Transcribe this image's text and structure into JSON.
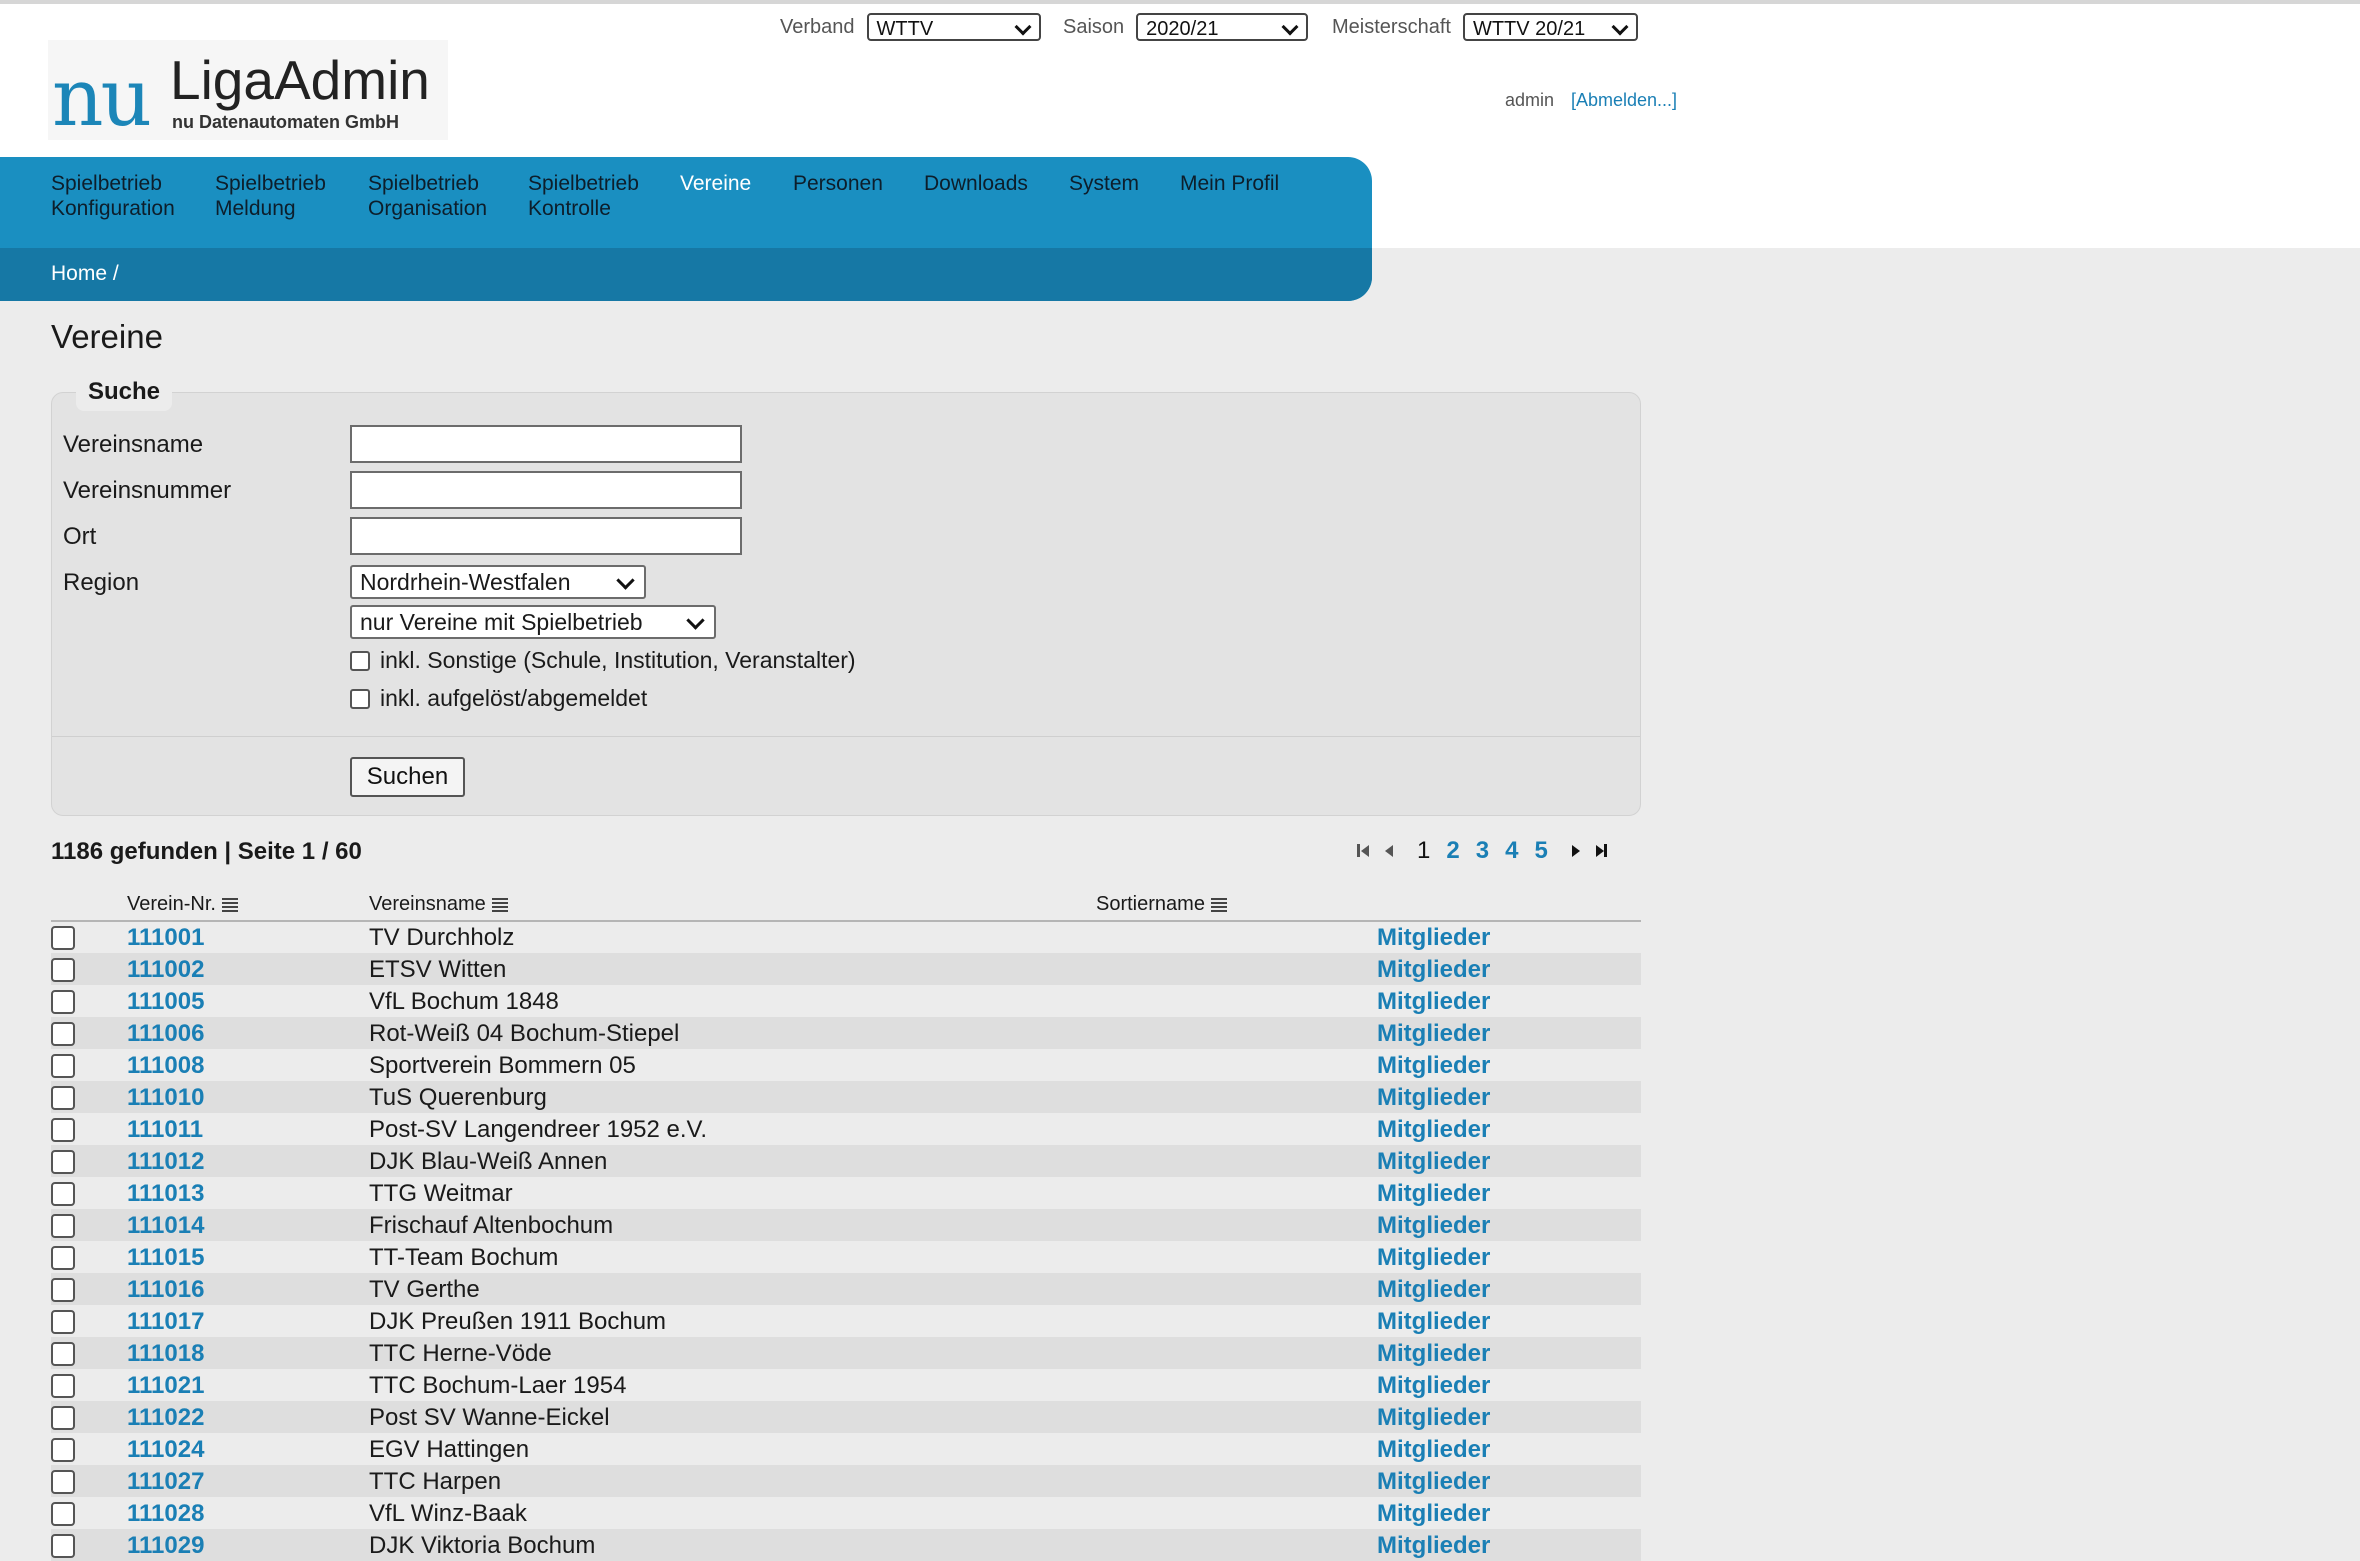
{
  "topbar": {
    "verband": {
      "label": "Verband",
      "value": "WTTV"
    },
    "saison": {
      "label": "Saison",
      "value": "2020/21"
    },
    "meisterschaft": {
      "label": "Meisterschaft",
      "value": "WTTV 20/21"
    }
  },
  "logo": {
    "nu": "nu",
    "title": "LigaAdmin",
    "subtitle": "nu Datenautomaten GmbH"
  },
  "user": {
    "name": "admin",
    "logout": "[Abmelden...]"
  },
  "nav": {
    "items": [
      {
        "line1": "Spielbetrieb",
        "line2": "Konfiguration"
      },
      {
        "line1": "Spielbetrieb",
        "line2": "Meldung"
      },
      {
        "line1": "Spielbetrieb",
        "line2": "Organisation"
      },
      {
        "line1": "Spielbetrieb",
        "line2": "Kontrolle"
      },
      {
        "line1": "Vereine",
        "line2": ""
      },
      {
        "line1": "Personen",
        "line2": ""
      },
      {
        "line1": "Downloads",
        "line2": ""
      },
      {
        "line1": "System",
        "line2": ""
      },
      {
        "line1": "Mein Profil",
        "line2": ""
      }
    ],
    "active": "Vereine",
    "breadcrumb": "Home /"
  },
  "page": {
    "title": "Vereine"
  },
  "search": {
    "legend": "Suche",
    "vereinsname_label": "Vereinsname",
    "vereinsname_value": "",
    "vereinsnummer_label": "Vereinsnummer",
    "vereinsnummer_value": "",
    "ort_label": "Ort",
    "ort_value": "",
    "region_label": "Region",
    "region_value": "Nordrhein-Westfalen",
    "filter_value": "nur Vereine mit Spielbetrieb",
    "sonstige_label": "inkl. Sonstige (Schule, Institution, Veranstalter)",
    "sonstige_checked": false,
    "aufgeloest_label": "inkl. aufgelöst/abgemeldet",
    "aufgeloest_checked": false,
    "submit": "Suchen"
  },
  "results": {
    "summary": "1186 gefunden | Seite 1 / 60",
    "pages": [
      "1",
      "2",
      "3",
      "4",
      "5"
    ],
    "current_page": "1"
  },
  "table": {
    "columns": [
      "Verein-Nr.",
      "Vereinsname",
      "Sortiername"
    ],
    "action_label": "Mitglieder",
    "rows": [
      {
        "nr": "111001",
        "name": "TV Durchholz"
      },
      {
        "nr": "111002",
        "name": "ETSV Witten"
      },
      {
        "nr": "111005",
        "name": "VfL Bochum 1848"
      },
      {
        "nr": "111006",
        "name": "Rot-Weiß 04 Bochum-Stiepel"
      },
      {
        "nr": "111008",
        "name": "Sportverein Bommern 05"
      },
      {
        "nr": "111010",
        "name": "TuS Querenburg"
      },
      {
        "nr": "111011",
        "name": "Post-SV Langendreer 1952 e.V."
      },
      {
        "nr": "111012",
        "name": "DJK Blau-Weiß Annen"
      },
      {
        "nr": "111013",
        "name": "TTG Weitmar"
      },
      {
        "nr": "111014",
        "name": "Frischauf Altenbochum"
      },
      {
        "nr": "111015",
        "name": "TT-Team Bochum"
      },
      {
        "nr": "111016",
        "name": "TV Gerthe"
      },
      {
        "nr": "111017",
        "name": "DJK Preußen 1911 Bochum"
      },
      {
        "nr": "111018",
        "name": "TTC Herne-Vöde"
      },
      {
        "nr": "111021",
        "name": "TTC Bochum-Laer 1954"
      },
      {
        "nr": "111022",
        "name": "Post SV Wanne-Eickel"
      },
      {
        "nr": "111024",
        "name": "EGV Hattingen"
      },
      {
        "nr": "111027",
        "name": "TTC Harpen"
      },
      {
        "nr": "111028",
        "name": "VfL Winz-Baak"
      },
      {
        "nr": "111029",
        "name": "DJK Viktoria Bochum"
      }
    ]
  },
  "colors": {
    "accent": "#1a8fc1",
    "accent_dark": "#1678a5",
    "link": "#1a7fb5",
    "background": "#ececec"
  }
}
